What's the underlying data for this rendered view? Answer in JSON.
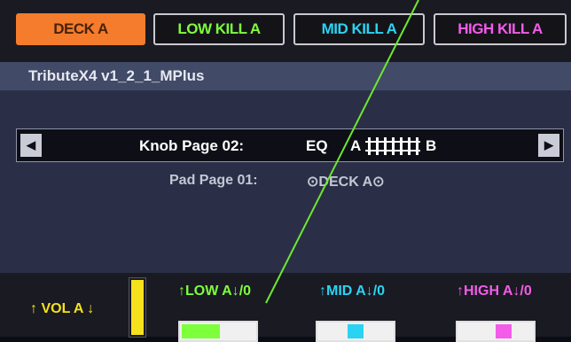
{
  "top_buttons": {
    "deck": "DECK A",
    "low_kill": "LOW KILL A",
    "mid_kill": "MID KILL A",
    "high_kill": "HIGH KILL A"
  },
  "title": "TributeX4 v1_2_1_MPlus",
  "knob_page": {
    "label": "Knob Page 02:",
    "eq": "EQ",
    "a": "A",
    "b": "B",
    "left_arrow_icon": "triangle-left-icon",
    "right_arrow_icon": "triangle-right-icon"
  },
  "pad_page": {
    "label": "Pad Page 01:",
    "value": "⊙DECK A⊙"
  },
  "mixer": {
    "vol_label": "↑ VOL A ↓",
    "vol_level": 1.0,
    "low_label": "↑LOW A↓/0",
    "mid_label": "↑MID A↓/0",
    "high_label": "↑HIGH A↓/0",
    "low_level": 0.55,
    "mid_position": 0.5,
    "high_position": 0.6
  },
  "colors": {
    "deck": "#f47c2c",
    "low": "#7dff3c",
    "mid": "#2bd3f2",
    "high": "#f25ce8",
    "vol": "#f5e21c"
  }
}
